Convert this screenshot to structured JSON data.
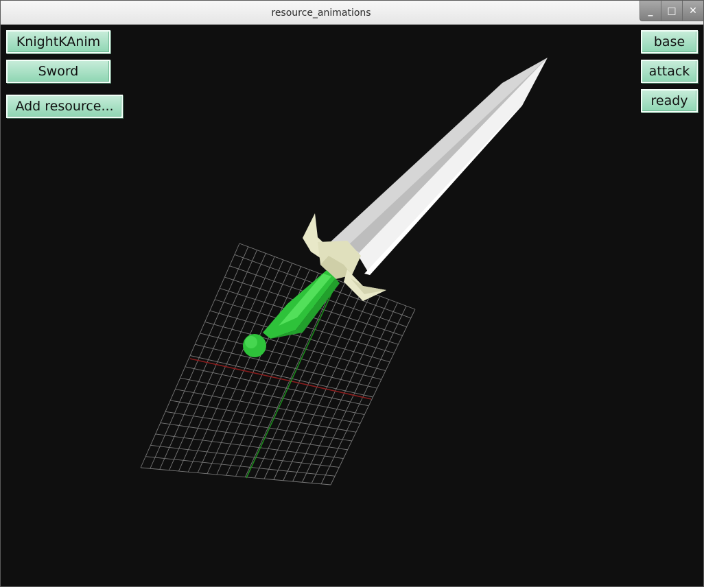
{
  "window": {
    "title": "resource_animations",
    "controls": {
      "minimize": "_",
      "maximize": "□",
      "close": "✕"
    }
  },
  "left_panel": {
    "resources": [
      "KnightKAnim",
      "Sword"
    ],
    "add_label": "Add resource..."
  },
  "right_panel": {
    "animations": [
      "base",
      "attack",
      "ready"
    ]
  },
  "colors": {
    "button_top": "#c6ecd9",
    "button_bottom": "#8fd6b3",
    "background": "#0f0f0f",
    "grid": "#8a8a8a",
    "x_axis": "#8a1e1e",
    "y_axis": "#1f8a1f",
    "blade": "#e6e6e6",
    "guard": "#e8e8c8",
    "handle": "#2ec23a"
  }
}
